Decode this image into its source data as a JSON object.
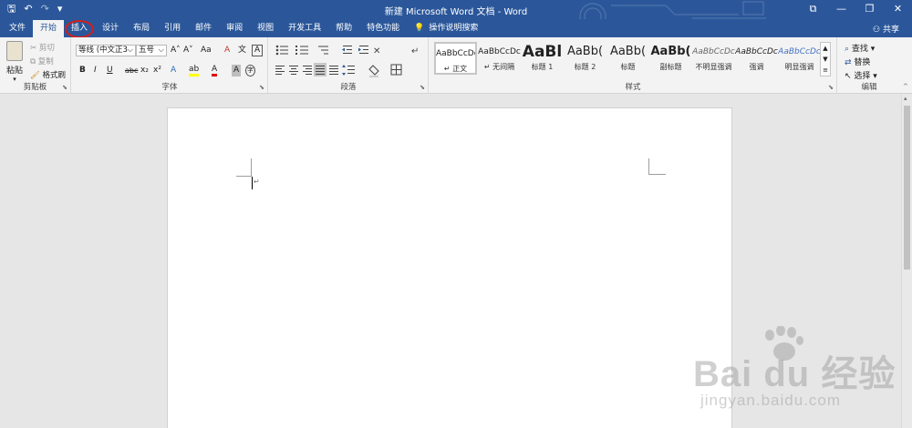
{
  "window": {
    "title": "新建 Microsoft Word 文档 - Word",
    "controls": [
      "⧉",
      "—",
      "❐",
      "✕"
    ]
  },
  "qat": {
    "save": "🖫",
    "undo": "↶",
    "redo": "↷",
    "customize": "▾"
  },
  "tabs": [
    "文件",
    "开始",
    "插入",
    "设计",
    "布局",
    "引用",
    "邮件",
    "审阅",
    "视图",
    "开发工具",
    "帮助",
    "特色功能"
  ],
  "active_tab": "开始",
  "highlighted_tab": "插入",
  "tell_me": "操作说明搜索",
  "share": "共享",
  "clipboard": {
    "paste": "粘贴",
    "cut": "剪切",
    "copy": "复制",
    "format_painter": "格式刷",
    "label": "剪贴板"
  },
  "font": {
    "name": "等线 (中文正3",
    "size": "五号",
    "grow": "A˄",
    "shrink": "A˅",
    "change_case": "Aa",
    "clear_format": "A",
    "phonetic": "文",
    "border": "A",
    "bold": "B",
    "italic": "I",
    "underline": "U",
    "strike": "abc",
    "subscript": "x₂",
    "superscript": "x²",
    "effects": "A",
    "highlight": "ab",
    "color": "A",
    "shading": "A",
    "enclose": "字",
    "label": "字体"
  },
  "paragraph": {
    "label": "段落"
  },
  "styles": {
    "label": "样式",
    "items": [
      {
        "preview": "AaBbCcDc",
        "name": "↵ 正文"
      },
      {
        "preview": "AaBbCcDc",
        "name": "↵ 无间隔"
      },
      {
        "preview": "AaBl",
        "name": "标题 1"
      },
      {
        "preview": "AaBb(",
        "name": "标题 2"
      },
      {
        "preview": "AaBb(",
        "name": "标题"
      },
      {
        "preview": "AaBb(",
        "name": "副标题"
      },
      {
        "preview": "AaBbCcDc",
        "name": "不明显强调"
      },
      {
        "preview": "AaBbCcDc",
        "name": "强调"
      },
      {
        "preview": "AaBbCcDc",
        "name": "明显强调"
      }
    ]
  },
  "editing": {
    "find": "查找",
    "replace": "替换",
    "select": "选择",
    "label": "编辑"
  },
  "document": {
    "paragraph_mark": "↵"
  },
  "watermark": {
    "logo": "Bai du 经验",
    "url": "jingyan.baidu.com"
  },
  "colors": {
    "accent": "#2b579a",
    "highlight_circle": "#d0201f",
    "font_red": "#e00000",
    "highlight_yellow": "#ffff00"
  }
}
